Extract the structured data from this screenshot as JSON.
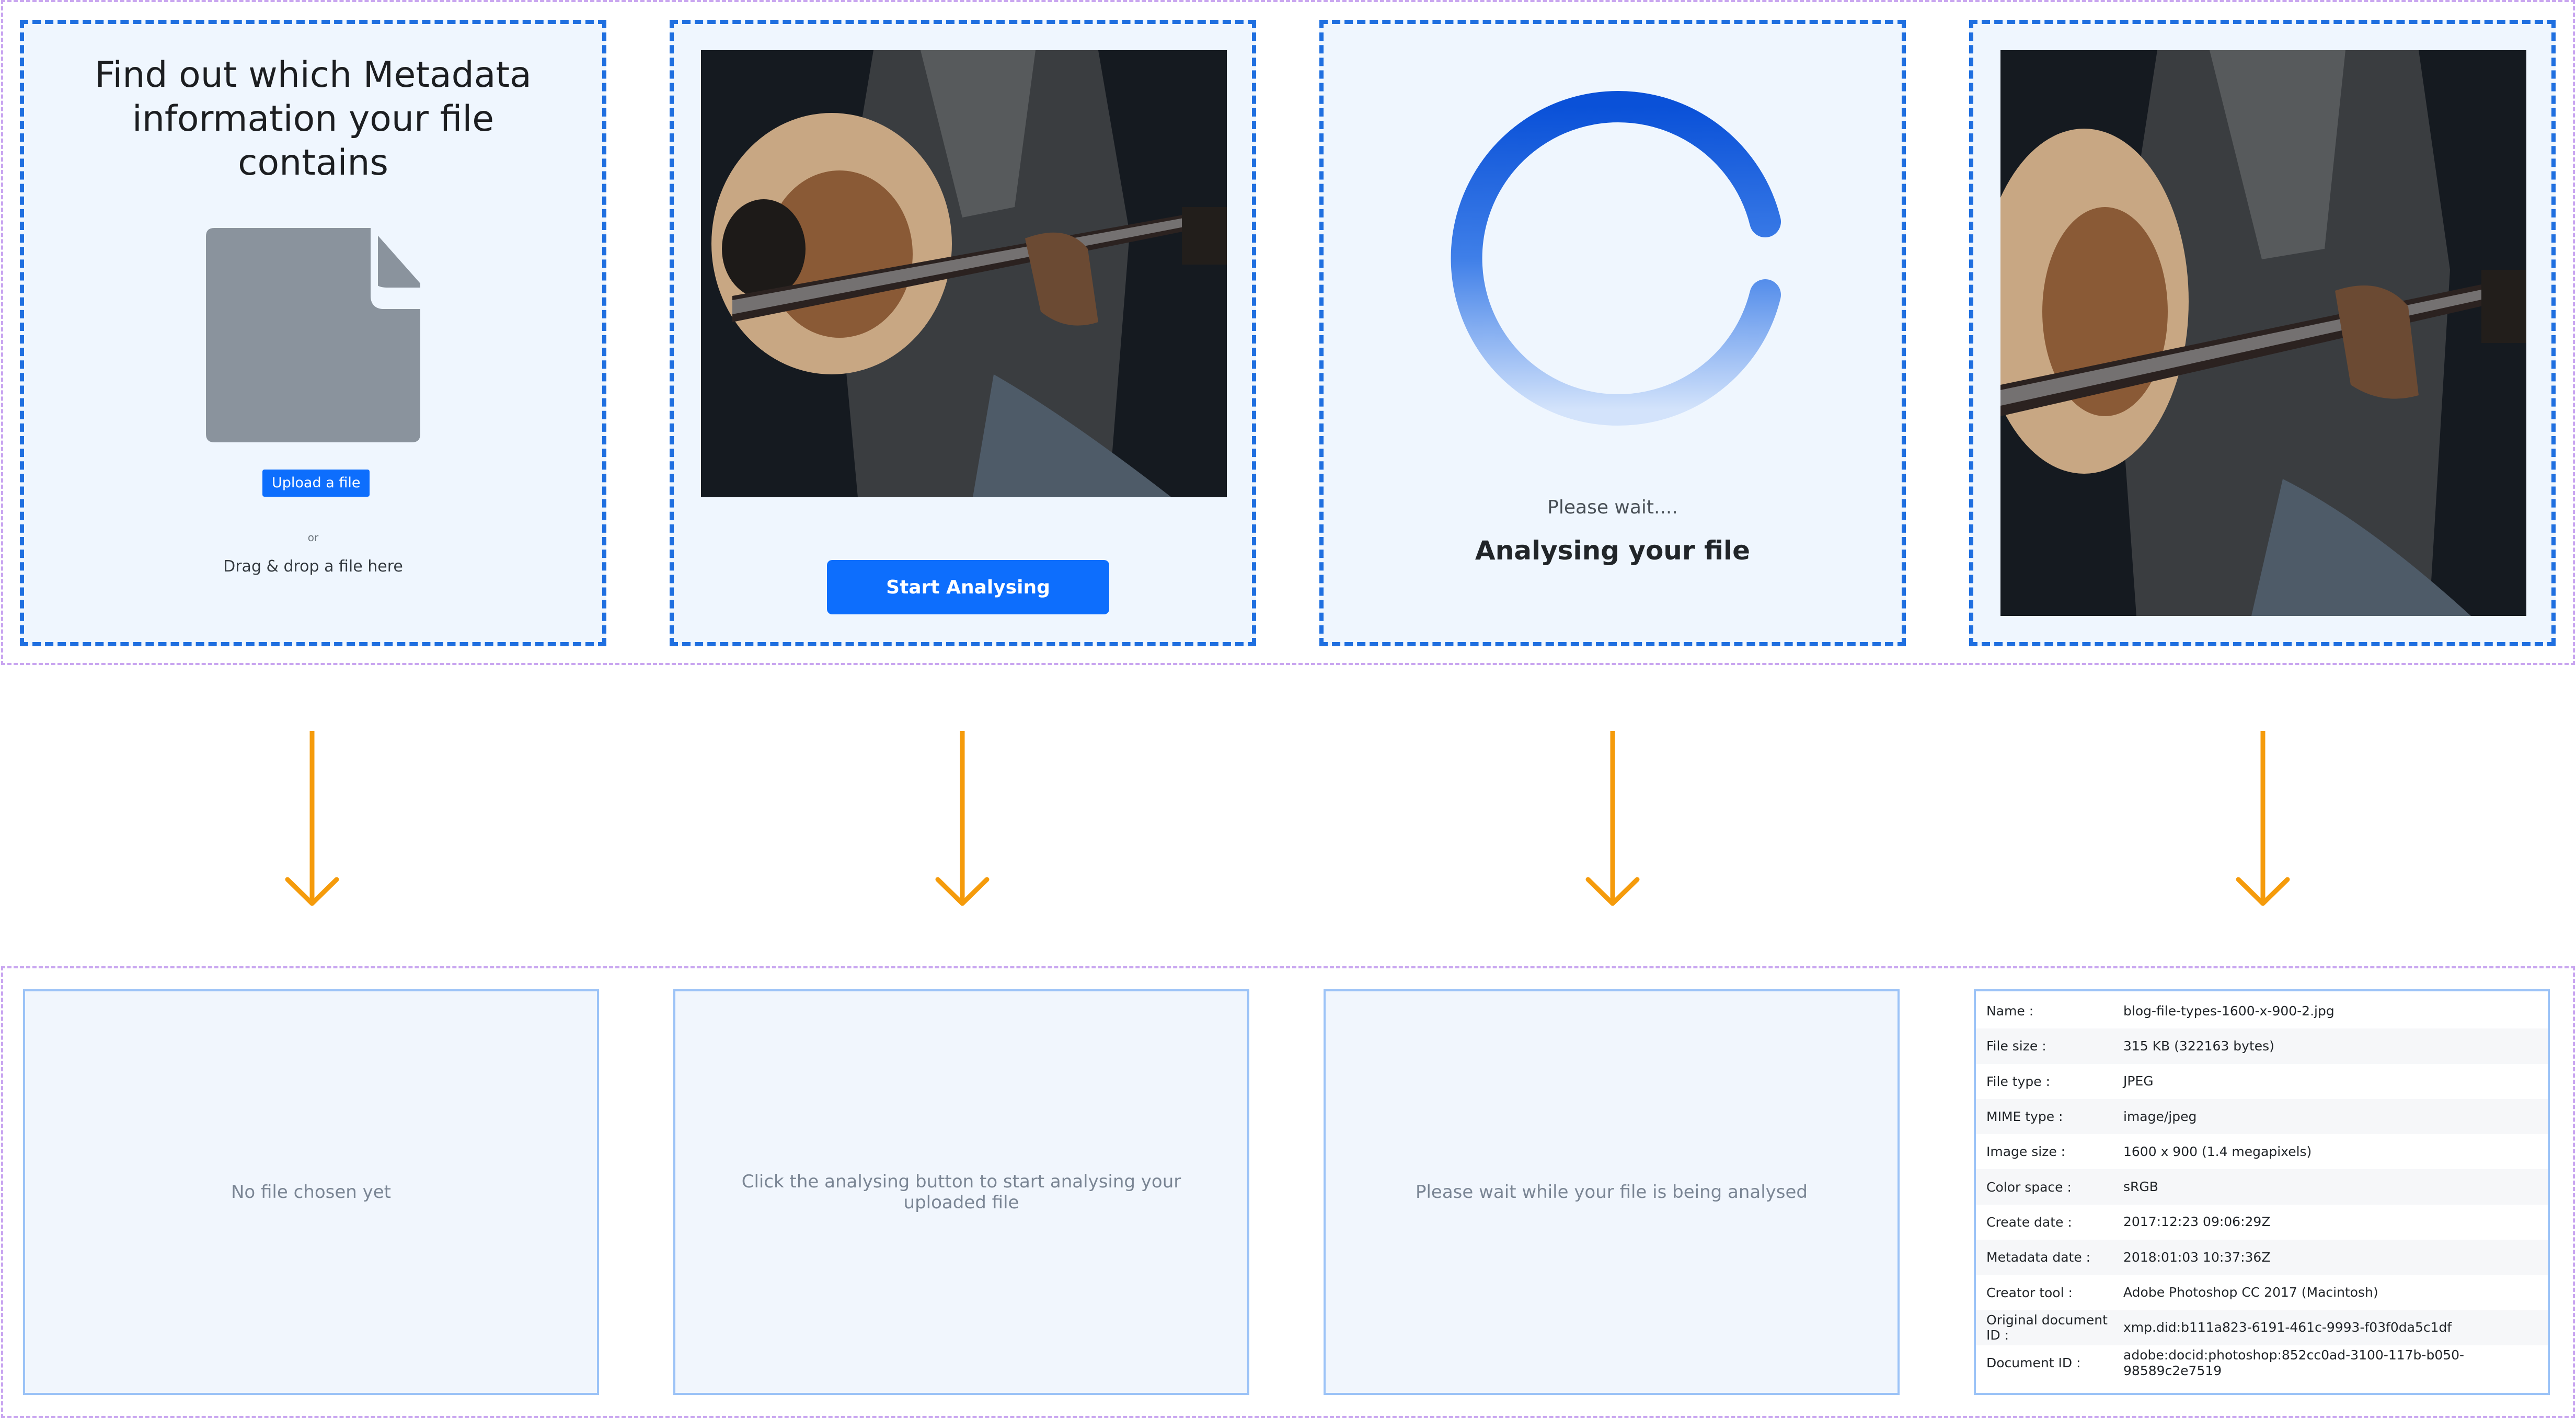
{
  "upload_card": {
    "title": "Find out which Metadata information your file contains",
    "upload_button": "Upload a file",
    "or": "or",
    "drag_drop": "Drag & drop a file here"
  },
  "preview_card": {
    "start_button": "Start Analysing"
  },
  "loading_card": {
    "wait": "Please wait....",
    "analysing": "Analysing your file"
  },
  "panels": {
    "empty": "No file chosen yet",
    "ready": "Click the analysing button to start analysing your uploaded file",
    "loading": "Please wait while your file is being analysed"
  },
  "metadata": [
    {
      "label": "Name :",
      "value": "blog-file-types-1600-x-900-2.jpg"
    },
    {
      "label": "File size :",
      "value": "315 KB (322163 bytes)"
    },
    {
      "label": "File type :",
      "value": "JPEG"
    },
    {
      "label": "MIME type :",
      "value": "image/jpeg"
    },
    {
      "label": "Image size :",
      "value": "1600 x 900 (1.4 megapixels)"
    },
    {
      "label": "Color space :",
      "value": "sRGB"
    },
    {
      "label": "Create date :",
      "value": "2017:12:23 09:06:29Z"
    },
    {
      "label": "Metadata date :",
      "value": "2018:01:03 10:37:36Z"
    },
    {
      "label": "Creator tool :",
      "value": "Adobe Photoshop CC 2017 (Macintosh)"
    },
    {
      "label": "Original document ID :",
      "value": "xmp.did:b111a823-6191-461c-9993-f03f0da5c1df"
    },
    {
      "label": "Document ID :",
      "value": "adobe:docid:photoshop:852cc0ad-3100-117b-b050-98589c2e7519"
    }
  ],
  "colors": {
    "primary": "#0d6efd",
    "card_border": "#1f6fe0",
    "card_bg": "#eff6fe",
    "arrow": "#f59b0b",
    "frame": "#c9a6f0",
    "panel_border": "#9cc3f7"
  },
  "icons": [
    "file-icon",
    "spinner-icon",
    "arrow-down-icon"
  ]
}
